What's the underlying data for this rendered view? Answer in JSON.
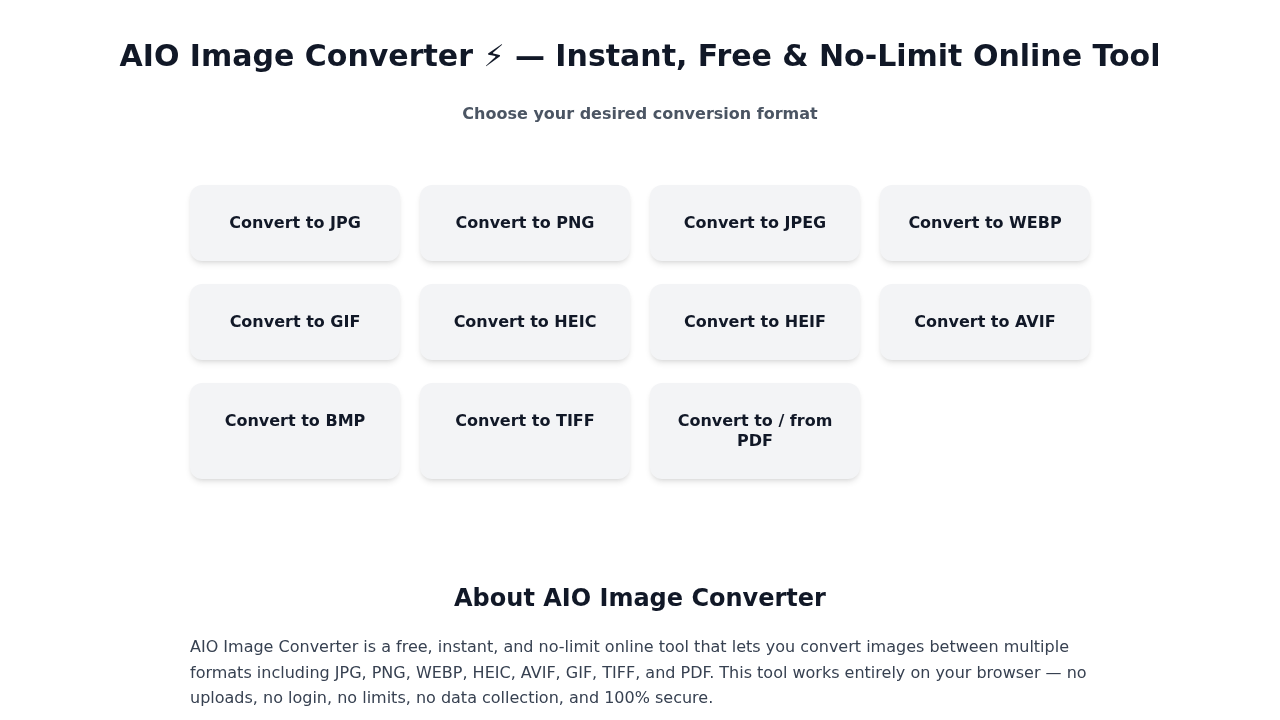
{
  "header": {
    "title": "AIO Image Converter ⚡ — Instant, Free & No-Limit Online Tool",
    "subtitle": "Choose your desired conversion format"
  },
  "formats": [
    "Convert to JPG",
    "Convert to PNG",
    "Convert to JPEG",
    "Convert to WEBP",
    "Convert to GIF",
    "Convert to HEIC",
    "Convert to HEIF",
    "Convert to AVIF",
    "Convert to BMP",
    "Convert to TIFF",
    "Convert to / from PDF"
  ],
  "about": {
    "heading": "About AIO Image Converter",
    "body": "AIO Image Converter is a free, instant, and no-limit online tool that lets you convert images between multiple formats including JPG, PNG, WEBP, HEIC, AVIF, GIF, TIFF, and PDF. This tool works entirely on your browser — no uploads, no login, no limits, no data collection, and 100% secure."
  }
}
